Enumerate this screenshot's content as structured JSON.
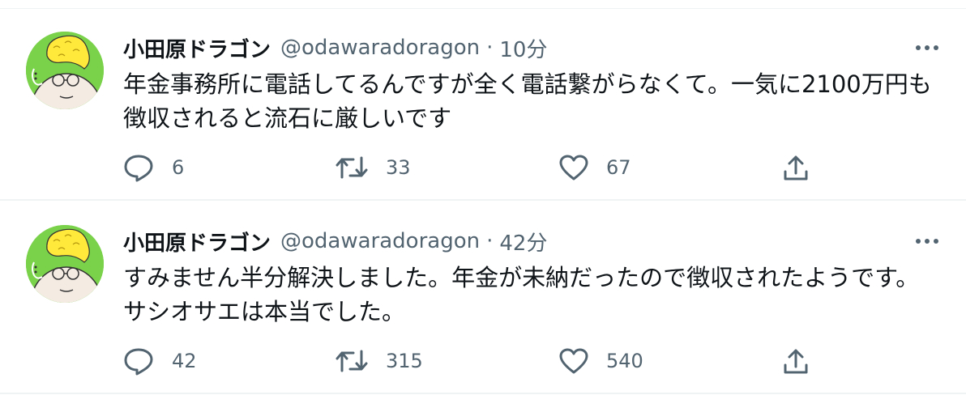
{
  "tweets": [
    {
      "name": "小田原ドラゴン",
      "handle": "@odawaradoragon",
      "separator": "·",
      "time": "10分",
      "text": "年金事務所に電話してるんですが全く電話繋がらなくて。一気に2100万円も徴収されると流石に厳しいです",
      "replies": "6",
      "retweets": "33",
      "likes": "67"
    },
    {
      "name": "小田原ドラゴン",
      "handle": "@odawaradoragon",
      "separator": "·",
      "time": "42分",
      "text": "すみません半分解決しました。年金が未納だったので徴収されたようです。サシオサエは本当でした。",
      "replies": "42",
      "retweets": "315",
      "likes": "540"
    }
  ],
  "icons": {
    "more": "more-horizontal-icon",
    "reply": "reply-bubble-icon",
    "retweet": "retweet-icon",
    "like": "heart-icon",
    "share": "share-upload-icon"
  },
  "colors": {
    "text": "#0f1419",
    "secondary": "#536471",
    "divider": "#eff3f4",
    "avatar_bg": "#7ad14a"
  }
}
